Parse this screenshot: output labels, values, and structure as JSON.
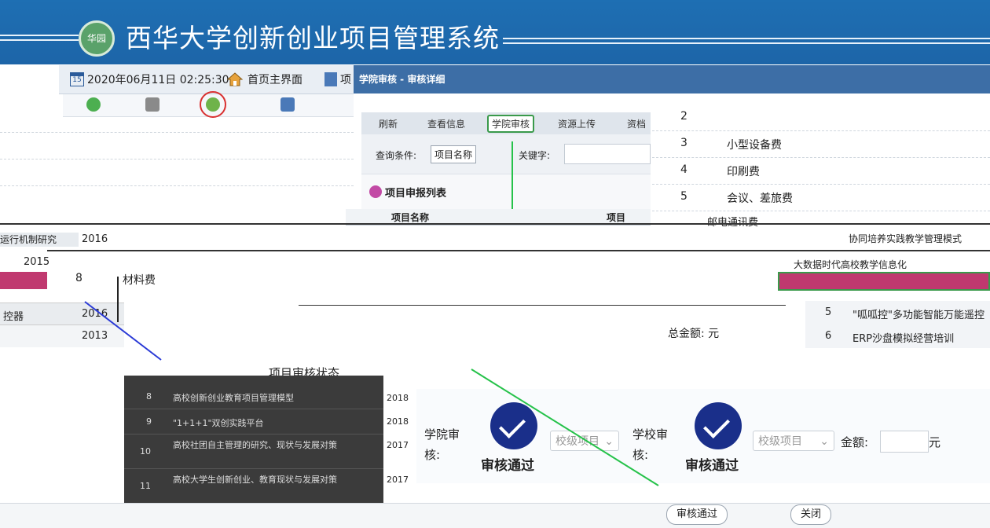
{
  "header": {
    "title": "西华大学创新创业项目管理系统",
    "logo_text": "华园"
  },
  "toolbar": {
    "date_icon_text": "15",
    "datetime": "2020年06月11日 02:25:30",
    "home_label": "首页主界面",
    "cut_label": "项"
  },
  "dialog": {
    "title": "学院审核 - 审核详细"
  },
  "inner": {
    "tabs": [
      "刷新",
      "查看信息",
      "学院审核",
      "资源上传",
      "资档"
    ],
    "query_label": "查询条件:",
    "query_select": "项目名称",
    "keyword_label": "关键字:",
    "list_title": "项目申报列表",
    "col_project_name": "项目名称",
    "col_cut": "项目"
  },
  "budget": {
    "rows": [
      {
        "no": "2",
        "name": ""
      },
      {
        "no": "3",
        "name": "小型设备费"
      },
      {
        "no": "4",
        "name": "印刷费"
      },
      {
        "no": "5",
        "name": "会议、差旅费"
      }
    ],
    "row6_text": "邮电通讯费",
    "row8_no": "8",
    "row8_name": "材料费",
    "total_label": "总金额: 元"
  },
  "left_list": {
    "row_a": "运行机制研究",
    "row_a_year": "2016",
    "row_b": "2015",
    "row_c_year": "2016",
    "row_c_name": "控器",
    "row_d_year": "2013"
  },
  "right_list": {
    "row3": "大数据时代高校教学信息化",
    "row5_no": "5",
    "row5_name": "\"呱呱控\"多功能智能万能遥控",
    "row6_no": "6",
    "row6_name": "ERP沙盘模拟经营培训",
    "row2_text": "协同培养实践教学管理模式"
  },
  "status_section": {
    "title": "项目审核状态"
  },
  "approval": {
    "college_label_1": "学院审",
    "college_label_2": "核:",
    "college_status": "审核通过",
    "college_level": "校级项目",
    "school_label_1": "学校审",
    "school_label_2": "核:",
    "school_status": "审核通过",
    "school_level": "校级项目",
    "amount_label": "金额:",
    "amount_unit": "元"
  },
  "dark_list": {
    "rows": [
      {
        "no": "8",
        "name": "高校创新创业教育项目管理模型",
        "year": "2018"
      },
      {
        "no": "9",
        "name": "\"1+1+1\"双创实践平台",
        "year": "2018"
      },
      {
        "no": "10",
        "name": "高校社团自主管理的研究、现状与发展对策",
        "year": "2017"
      },
      {
        "no": "11",
        "name": "高校大学生创新创业、教育现状与发展对策",
        "year": "2017"
      }
    ]
  },
  "bottom": {
    "btn_pass": "审核通过",
    "btn_close": "关闭"
  },
  "colors": {
    "header_blue": "#1e6fb3",
    "dialog_blue": "#3d6ea6",
    "check_navy": "#1a2f8a",
    "tab_green": "#3a9a4b",
    "pink_bar": "#c0396f"
  }
}
